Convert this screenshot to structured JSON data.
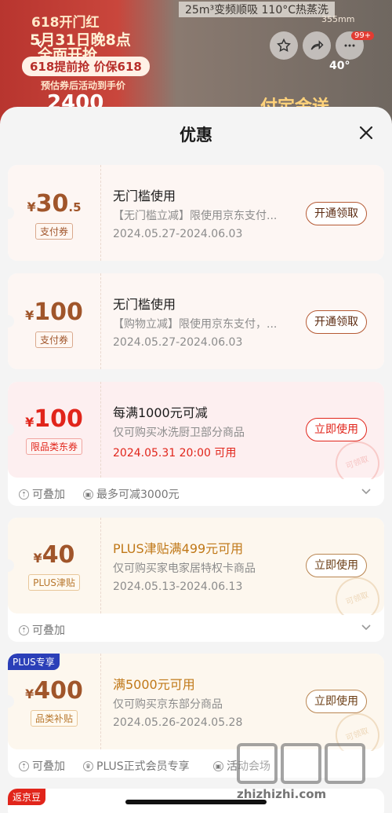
{
  "banner": {
    "line1": "618开门红",
    "line2": "5月31日晚8点",
    "line3": "全面开抢",
    "pill": "618提前抢 价保618",
    "sub": "预估券后活动到手价",
    "price": "2400",
    "spec": "25m³变频顺吸 110°C热蒸洗",
    "size": "355mm",
    "temp": "40°",
    "gold_text": "付定金送",
    "cart_badge": "99+"
  },
  "sheet": {
    "title": "优惠"
  },
  "coupons": [
    {
      "yen": "¥",
      "amount": "30",
      "decimal": ".5",
      "tag": "支付券",
      "title": "无门槛使用",
      "desc": "【无门槛立减】限使用京东支付...",
      "date": "2024.05.27-2024.06.03",
      "button": "开通领取"
    },
    {
      "yen": "¥",
      "amount": "100",
      "decimal": "",
      "tag": "支付券",
      "title": "无门槛使用",
      "desc": "【购物立减】限使用京东支付，...",
      "date": "2024.05.27-2024.06.03",
      "button": "开通领取"
    },
    {
      "yen": "¥",
      "amount": "100",
      "decimal": "",
      "tag": "限品类东券",
      "title": "每满1000元可减",
      "desc": "仅可购买冰洗厨卫部分商品",
      "date": "2024.05.31 20:00 可用",
      "button": "立即使用",
      "stamp": "可领取",
      "footer": [
        "可叠加",
        "最多可减3000元"
      ]
    },
    {
      "yen": "¥",
      "amount": "40",
      "decimal": "",
      "tag": "PLUS津贴",
      "title": "PLUS津贴满499元可用",
      "desc": "仅可购买家电家居特权卡商品",
      "date": "2024.05.13-2024.06.13",
      "button": "立即使用",
      "stamp": "可领取",
      "footer": [
        "可叠加"
      ]
    },
    {
      "badge": "PLUS专享",
      "yen": "¥",
      "amount": "400",
      "decimal": "",
      "tag": "品类补贴",
      "title": "满5000元可用",
      "desc": "仅可购买京东部分商品",
      "date": "2024.05.26-2024.05.28",
      "button": "立即使用",
      "stamp": "可领取",
      "footer": [
        "可叠加",
        "PLUS正式会员专享",
        "活动会场"
      ]
    }
  ],
  "peek": {
    "badge": "返京豆"
  },
  "watermark": {
    "url": "zhizhizhi.com"
  },
  "colors": {
    "red": "#e1251b",
    "gold": "#c07818",
    "plus_blue": "#2b3fb8",
    "brown": "#a0552a"
  }
}
